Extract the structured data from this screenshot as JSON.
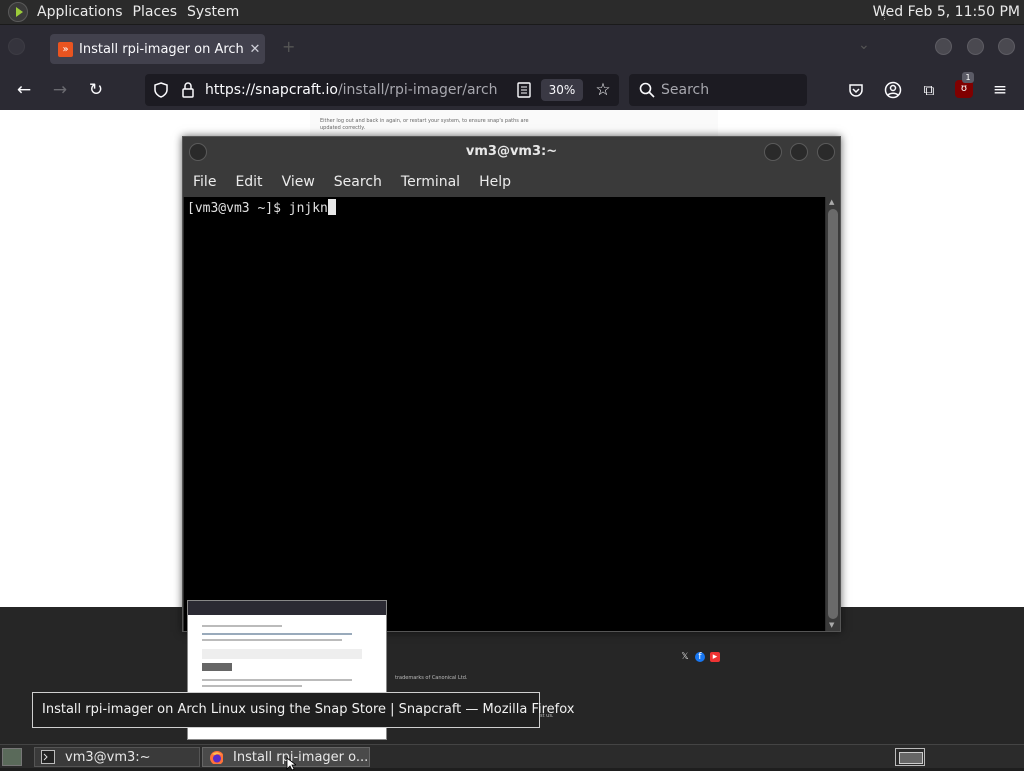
{
  "top_panel": {
    "menus": [
      "Applications",
      "Places",
      "System"
    ],
    "clock": "Wed Feb  5, 11:50 PM"
  },
  "firefox": {
    "tab_title": "Install rpi-imager on Arch L",
    "tab_close": "✕",
    "url_host": "https://snapcraft.io",
    "url_path": "/install/rpi-imager/arch",
    "zoom": "30%",
    "search_placeholder": "Search",
    "extension_badge": "1",
    "page_text": "Either log out and back in again, or restart your system, to ensure snap's paths are updated correctly.",
    "footer_text1": "trademarks of Canonical Ltd.",
    "footer_text2": "st us."
  },
  "terminal": {
    "title": "vm3@vm3:~",
    "menu": [
      "File",
      "Edit",
      "View",
      "Search",
      "Terminal",
      "Help"
    ],
    "prompt": "[vm3@vm3 ~]$ ",
    "input": "jnjkn"
  },
  "tooltip": {
    "text": "Install rpi-imager on Arch Linux using the Snap Store | Snapcraft — Mozilla Firefox"
  },
  "taskbar": {
    "items": [
      {
        "label": "vm3@vm3:~"
      },
      {
        "label": "Install rpi-imager o..."
      }
    ]
  },
  "colors": {
    "panel_bg": "#2b2b2b",
    "firefox_chrome": "#2b2a33",
    "terminal_bg": "#000000",
    "snapcraft_accent": "#e95420"
  }
}
